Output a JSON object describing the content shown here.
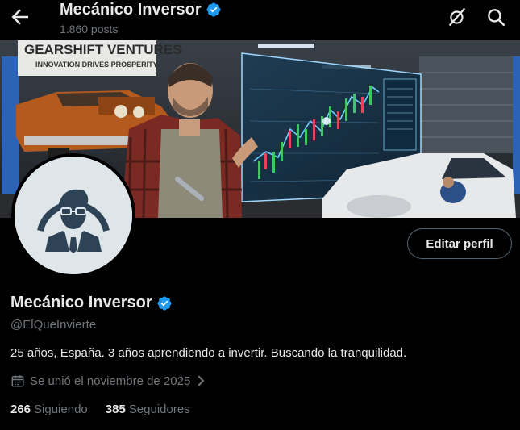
{
  "header": {
    "title": "Mecánico Inversor",
    "posts": "1.860 posts",
    "back_icon": "arrow-left-icon",
    "grok_icon": "grok-icon",
    "search_icon": "search-icon"
  },
  "banner": {
    "sign_line1": "GEARSHIFT VENTURES",
    "sign_line2": "INNOVATION DRIVES PROSPERITY"
  },
  "profile": {
    "name": "Mecánico Inversor",
    "handle": "@ElQueInvierte",
    "bio": "25 años, España. 3 años aprendiendo a invertir. Buscando la tranquilidad.",
    "joined": "Se unió el noviembre de 2025",
    "edit_label": "Editar perfil",
    "following_count": "266",
    "following_label": "Siguiendo",
    "followers_count": "385",
    "followers_label": "Seguidores",
    "verified_color": "#1d9bf0"
  }
}
